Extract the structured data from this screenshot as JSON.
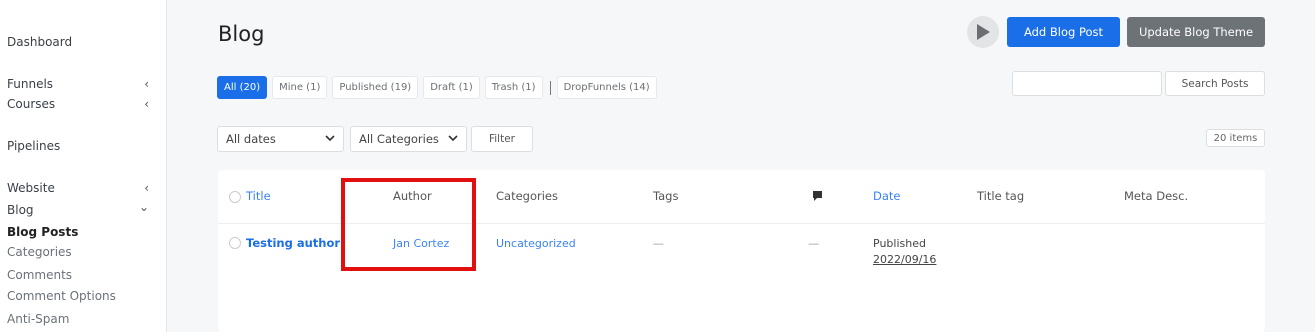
{
  "sidebar": {
    "dashboard": "Dashboard",
    "funnels": "Funnels",
    "courses": "Courses",
    "pipelines": "Pipelines",
    "website": "Website",
    "blog": "Blog",
    "blog_posts": "Blog Posts",
    "categories": "Categories",
    "comments": "Comments",
    "comment_options": "Comment Options",
    "anti_spam": "Anti-Spam",
    "chevron_left": "‹",
    "chevron_down": "⌄"
  },
  "header": {
    "title": "Blog",
    "add_label": "Add Blog Post",
    "theme_label": "Update Blog Theme",
    "primary_color": "#1a6fe8"
  },
  "status_tabs": [
    {
      "label": "All (20)",
      "active": true
    },
    {
      "label": "Mine (1)"
    },
    {
      "label": "Published (19)"
    },
    {
      "label": "Draft (1)"
    },
    {
      "label": "Trash (1)"
    },
    {
      "label": "DropFunnels (14)"
    }
  ],
  "search": {
    "button_label": "Search Posts",
    "value": ""
  },
  "filters": {
    "dates_selected": "All dates",
    "categories_selected": "All Categories",
    "filter_label": "Filter",
    "items_count": "20 items"
  },
  "table": {
    "columns": {
      "title": "Title",
      "author": "Author",
      "categories": "Categories",
      "tags": "Tags",
      "date": "Date",
      "title_tag": "Title tag",
      "meta_desc": "Meta Desc."
    },
    "rows": [
      {
        "title": "Testing author",
        "author": "Jan Cortez",
        "category": "Uncategorized",
        "tags": "—",
        "comments": "—",
        "status": "Published",
        "date": "2022/09/16"
      }
    ]
  }
}
